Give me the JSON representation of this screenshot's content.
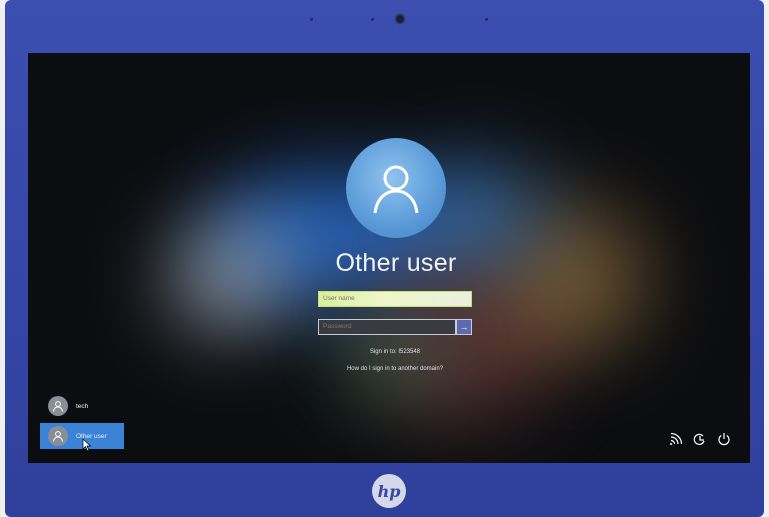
{
  "lock_screen": {
    "title": "Other user",
    "username_placeholder": "User name",
    "password_placeholder": "Password",
    "sign_in_to": "Sign in to: I523548",
    "other_domain_link": "How do I sign in to another domain?"
  },
  "user_switcher": {
    "users": [
      {
        "name": "tech"
      },
      {
        "name": "Other user"
      }
    ],
    "selected": "Other user"
  },
  "system_icons": [
    "network-icon",
    "ease-of-access-icon",
    "power-icon"
  ],
  "device": {
    "brand_logo": "hp"
  },
  "colors": {
    "accent": "#3b83d6",
    "avatar": "#5a9ad8",
    "bezel": "#3446a6"
  }
}
